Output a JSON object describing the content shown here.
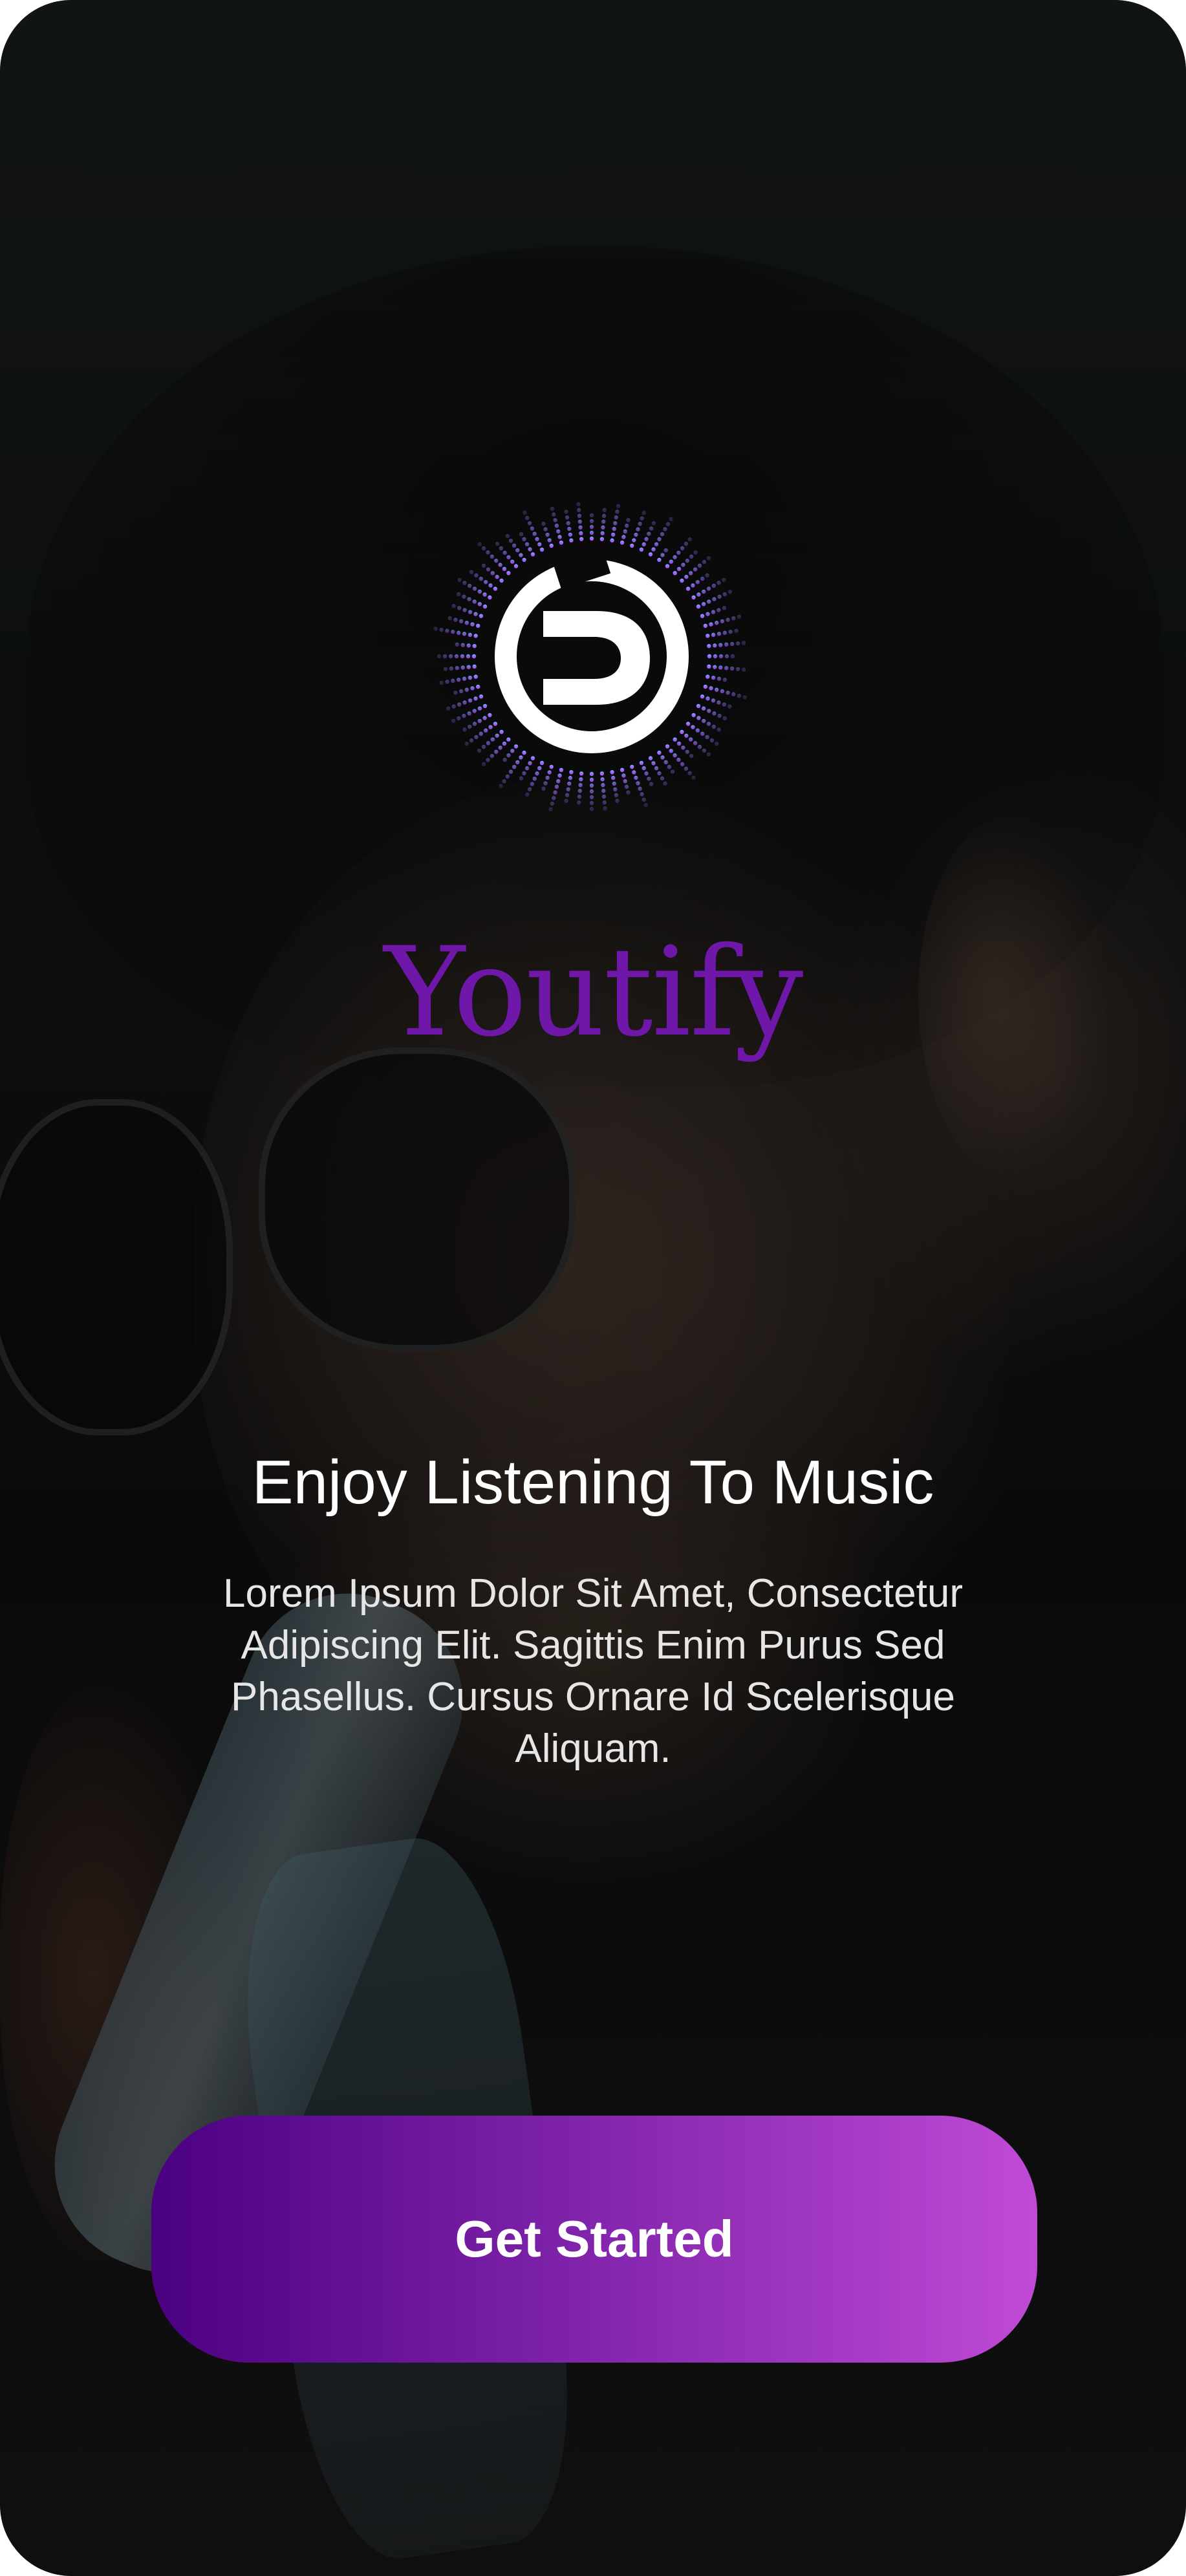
{
  "app": {
    "name": "Youtify",
    "logo_icon": "youtify-logo-icon"
  },
  "onboarding": {
    "headline": "Enjoy Listening To Music",
    "description": "Lorem Ipsum Dolor Sit Amet, Consectetur Adipiscing Elit. Sagittis Enim Purus Sed Phasellus. Cursus Ornare Id Scelerisque Aliquam.",
    "cta_label": "Get Started"
  },
  "colors": {
    "brand_purple": "#6e17a8",
    "button_gradient_start": "#4b0082",
    "button_gradient_end": "#c04ad6",
    "logo_ring_top": "#7fb6ff",
    "logo_ring_bottom": "#e044ff"
  }
}
